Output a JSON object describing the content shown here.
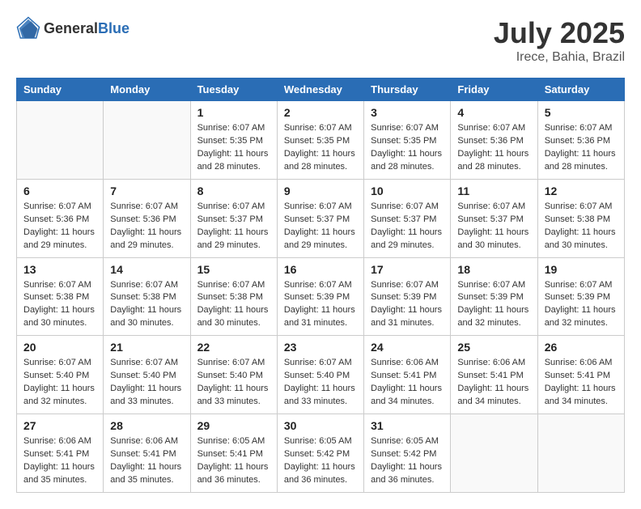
{
  "header": {
    "logo_general": "General",
    "logo_blue": "Blue",
    "month_year": "July 2025",
    "location": "Irece, Bahia, Brazil"
  },
  "days_of_week": [
    "Sunday",
    "Monday",
    "Tuesday",
    "Wednesday",
    "Thursday",
    "Friday",
    "Saturday"
  ],
  "weeks": [
    [
      {
        "day": "",
        "info": ""
      },
      {
        "day": "",
        "info": ""
      },
      {
        "day": "1",
        "info": "Sunrise: 6:07 AM\nSunset: 5:35 PM\nDaylight: 11 hours and 28 minutes."
      },
      {
        "day": "2",
        "info": "Sunrise: 6:07 AM\nSunset: 5:35 PM\nDaylight: 11 hours and 28 minutes."
      },
      {
        "day": "3",
        "info": "Sunrise: 6:07 AM\nSunset: 5:35 PM\nDaylight: 11 hours and 28 minutes."
      },
      {
        "day": "4",
        "info": "Sunrise: 6:07 AM\nSunset: 5:36 PM\nDaylight: 11 hours and 28 minutes."
      },
      {
        "day": "5",
        "info": "Sunrise: 6:07 AM\nSunset: 5:36 PM\nDaylight: 11 hours and 28 minutes."
      }
    ],
    [
      {
        "day": "6",
        "info": "Sunrise: 6:07 AM\nSunset: 5:36 PM\nDaylight: 11 hours and 29 minutes."
      },
      {
        "day": "7",
        "info": "Sunrise: 6:07 AM\nSunset: 5:36 PM\nDaylight: 11 hours and 29 minutes."
      },
      {
        "day": "8",
        "info": "Sunrise: 6:07 AM\nSunset: 5:37 PM\nDaylight: 11 hours and 29 minutes."
      },
      {
        "day": "9",
        "info": "Sunrise: 6:07 AM\nSunset: 5:37 PM\nDaylight: 11 hours and 29 minutes."
      },
      {
        "day": "10",
        "info": "Sunrise: 6:07 AM\nSunset: 5:37 PM\nDaylight: 11 hours and 29 minutes."
      },
      {
        "day": "11",
        "info": "Sunrise: 6:07 AM\nSunset: 5:37 PM\nDaylight: 11 hours and 30 minutes."
      },
      {
        "day": "12",
        "info": "Sunrise: 6:07 AM\nSunset: 5:38 PM\nDaylight: 11 hours and 30 minutes."
      }
    ],
    [
      {
        "day": "13",
        "info": "Sunrise: 6:07 AM\nSunset: 5:38 PM\nDaylight: 11 hours and 30 minutes."
      },
      {
        "day": "14",
        "info": "Sunrise: 6:07 AM\nSunset: 5:38 PM\nDaylight: 11 hours and 30 minutes."
      },
      {
        "day": "15",
        "info": "Sunrise: 6:07 AM\nSunset: 5:38 PM\nDaylight: 11 hours and 30 minutes."
      },
      {
        "day": "16",
        "info": "Sunrise: 6:07 AM\nSunset: 5:39 PM\nDaylight: 11 hours and 31 minutes."
      },
      {
        "day": "17",
        "info": "Sunrise: 6:07 AM\nSunset: 5:39 PM\nDaylight: 11 hours and 31 minutes."
      },
      {
        "day": "18",
        "info": "Sunrise: 6:07 AM\nSunset: 5:39 PM\nDaylight: 11 hours and 32 minutes."
      },
      {
        "day": "19",
        "info": "Sunrise: 6:07 AM\nSunset: 5:39 PM\nDaylight: 11 hours and 32 minutes."
      }
    ],
    [
      {
        "day": "20",
        "info": "Sunrise: 6:07 AM\nSunset: 5:40 PM\nDaylight: 11 hours and 32 minutes."
      },
      {
        "day": "21",
        "info": "Sunrise: 6:07 AM\nSunset: 5:40 PM\nDaylight: 11 hours and 33 minutes."
      },
      {
        "day": "22",
        "info": "Sunrise: 6:07 AM\nSunset: 5:40 PM\nDaylight: 11 hours and 33 minutes."
      },
      {
        "day": "23",
        "info": "Sunrise: 6:07 AM\nSunset: 5:40 PM\nDaylight: 11 hours and 33 minutes."
      },
      {
        "day": "24",
        "info": "Sunrise: 6:06 AM\nSunset: 5:41 PM\nDaylight: 11 hours and 34 minutes."
      },
      {
        "day": "25",
        "info": "Sunrise: 6:06 AM\nSunset: 5:41 PM\nDaylight: 11 hours and 34 minutes."
      },
      {
        "day": "26",
        "info": "Sunrise: 6:06 AM\nSunset: 5:41 PM\nDaylight: 11 hours and 34 minutes."
      }
    ],
    [
      {
        "day": "27",
        "info": "Sunrise: 6:06 AM\nSunset: 5:41 PM\nDaylight: 11 hours and 35 minutes."
      },
      {
        "day": "28",
        "info": "Sunrise: 6:06 AM\nSunset: 5:41 PM\nDaylight: 11 hours and 35 minutes."
      },
      {
        "day": "29",
        "info": "Sunrise: 6:05 AM\nSunset: 5:41 PM\nDaylight: 11 hours and 36 minutes."
      },
      {
        "day": "30",
        "info": "Sunrise: 6:05 AM\nSunset: 5:42 PM\nDaylight: 11 hours and 36 minutes."
      },
      {
        "day": "31",
        "info": "Sunrise: 6:05 AM\nSunset: 5:42 PM\nDaylight: 11 hours and 36 minutes."
      },
      {
        "day": "",
        "info": ""
      },
      {
        "day": "",
        "info": ""
      }
    ]
  ]
}
